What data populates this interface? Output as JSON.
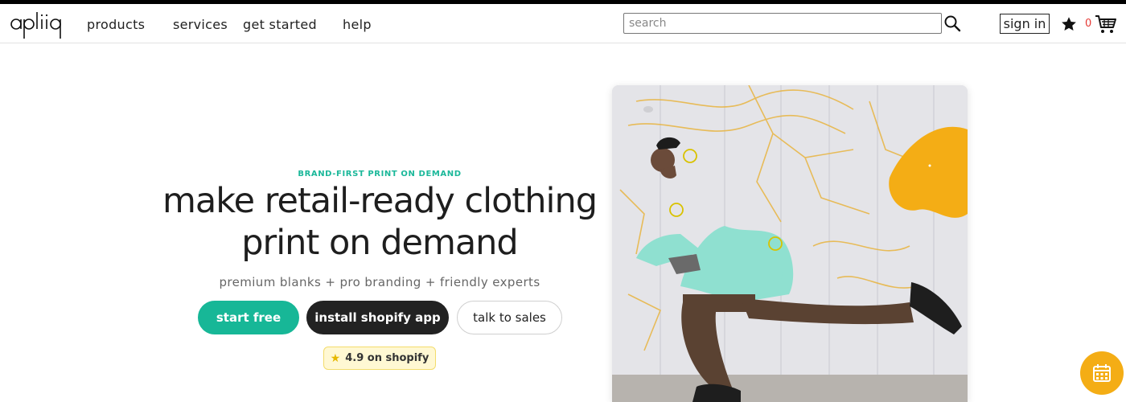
{
  "header": {
    "logo_text": "apliiq",
    "nav": [
      {
        "label": "products"
      },
      {
        "label": "services"
      },
      {
        "label": "get started"
      },
      {
        "label": "help"
      }
    ],
    "search": {
      "placeholder": "search",
      "value": ""
    },
    "sign_in_label": "sign in",
    "cart_count": "0",
    "icons": {
      "search": "search-icon",
      "favorites": "star-icon",
      "cart": "cart-icon"
    }
  },
  "hero": {
    "eyebrow": "BRAND-FIRST PRINT ON DEMAND",
    "headline_line1": "make retail-ready clothing",
    "headline_line2": "print on demand",
    "subhead": "premium blanks + pro branding + friendly experts",
    "buttons": {
      "start_free": "start free",
      "install_shopify": "install shopify app",
      "talk_to_sales": "talk to sales"
    },
    "rating": {
      "star": "★",
      "text": "4.9 on shopify"
    },
    "image_alt": "skater wearing a mint sweatshirt with custom branding against a mural wall"
  },
  "floating": {
    "calendar_icon": "calendar-icon"
  },
  "colors": {
    "accent": "#17b797",
    "dark_button": "#222222",
    "rating_bg": "#fff8d3",
    "calendar_button": "#f4ad15",
    "cart_count": "#e53935"
  }
}
